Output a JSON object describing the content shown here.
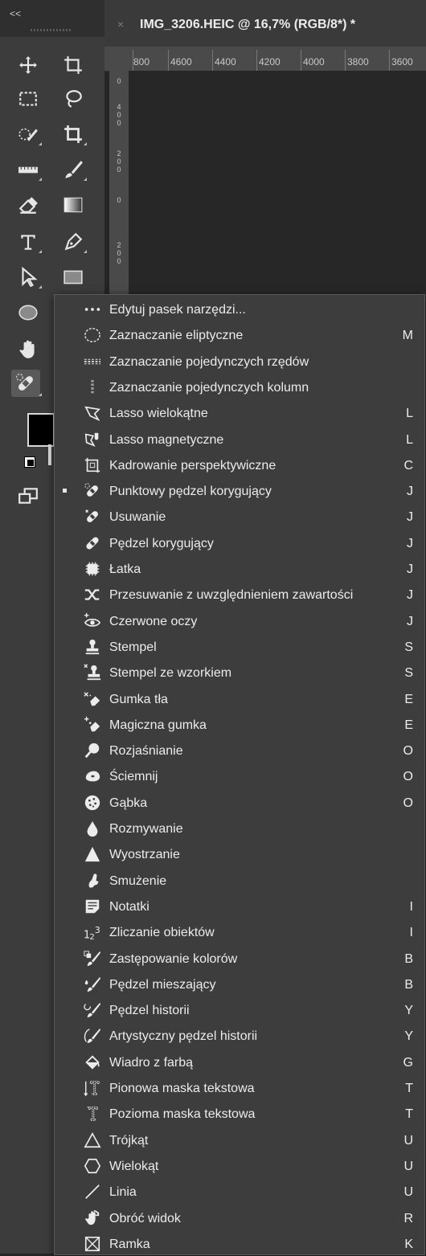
{
  "toolbar": {
    "collapse_label": "<<",
    "tools": [
      {
        "name": "move-tool",
        "icon": "move-icon"
      },
      {
        "name": "artboard-tool",
        "icon": "artboard-icon"
      },
      {
        "name": "rectangular-marquee-tool",
        "icon": "marquee-icon"
      },
      {
        "name": "lasso-tool",
        "icon": "lasso-icon"
      },
      {
        "name": "quick-selection-tool",
        "icon": "quick-selection-icon"
      },
      {
        "name": "crop-tool",
        "icon": "crop-icon"
      },
      {
        "name": "ruler-tool",
        "icon": "ruler-icon"
      },
      {
        "name": "brush-tool",
        "icon": "brush-icon"
      },
      {
        "name": "eraser-tool",
        "icon": "eraser-icon"
      },
      {
        "name": "gradient-tool",
        "icon": "gradient-icon"
      },
      {
        "name": "type-tool",
        "icon": "type-icon"
      },
      {
        "name": "pen-tool",
        "icon": "pen-icon"
      },
      {
        "name": "path-selection-tool",
        "icon": "arrow-icon"
      },
      {
        "name": "rectangle-tool",
        "icon": "rectangle-icon"
      },
      {
        "name": "ellipse-tool",
        "icon": "ellipse-icon"
      },
      {
        "name": "hand-tool",
        "icon": "hand-icon"
      },
      {
        "name": "spot-healing-brush-tool",
        "icon": "bandage-icon"
      },
      {
        "name": "change-screen-mode",
        "icon": "screen-mode-icon"
      }
    ],
    "foreground_color": "#000000"
  },
  "document": {
    "tab_close": "×",
    "tab_title": "IMG_3206.HEIC @ 16,7% (RGB/8*) *",
    "ruler_h": [
      "800",
      "4600",
      "4400",
      "4200",
      "4000",
      "3800",
      "3600"
    ],
    "ruler_v": [
      "0",
      "400",
      "200",
      "0",
      "200"
    ]
  },
  "menu": {
    "items": [
      {
        "icon": "ellipsis-icon",
        "label": "Edytuj pasek narzędzi...",
        "shortcut": ""
      },
      {
        "icon": "elliptical-marquee-icon",
        "label": "Zaznaczanie eliptyczne",
        "shortcut": "M"
      },
      {
        "icon": "single-row-marquee-icon",
        "label": "Zaznaczanie pojedynczych rzędów",
        "shortcut": ""
      },
      {
        "icon": "single-column-marquee-icon",
        "label": "Zaznaczanie pojedynczych kolumn",
        "shortcut": ""
      },
      {
        "icon": "polygonal-lasso-icon",
        "label": "Lasso wielokątne",
        "shortcut": "L"
      },
      {
        "icon": "magnetic-lasso-icon",
        "label": "Lasso magnetyczne",
        "shortcut": "L"
      },
      {
        "icon": "perspective-crop-icon",
        "label": "Kadrowanie perspektywiczne",
        "shortcut": "C"
      },
      {
        "icon": "spot-healing-brush-icon",
        "label": "Punktowy pędzel korygujący",
        "shortcut": "J",
        "selected": true
      },
      {
        "icon": "remove-tool-icon",
        "label": "Usuwanie",
        "shortcut": "J"
      },
      {
        "icon": "healing-brush-icon",
        "label": "Pędzel korygujący",
        "shortcut": "J"
      },
      {
        "icon": "patch-icon",
        "label": "Łatka",
        "shortcut": "J"
      },
      {
        "icon": "content-aware-move-icon",
        "label": "Przesuwanie z uwzględnieniem zawartości",
        "shortcut": "J"
      },
      {
        "icon": "red-eye-icon",
        "label": "Czerwone oczy",
        "shortcut": "J"
      },
      {
        "icon": "clone-stamp-icon",
        "label": "Stempel",
        "shortcut": "S"
      },
      {
        "icon": "pattern-stamp-icon",
        "label": "Stempel ze wzorkiem",
        "shortcut": "S"
      },
      {
        "icon": "background-eraser-icon",
        "label": "Gumka tła",
        "shortcut": "E"
      },
      {
        "icon": "magic-eraser-icon",
        "label": "Magiczna gumka",
        "shortcut": "E"
      },
      {
        "icon": "dodge-icon",
        "label": "Rozjaśnianie",
        "shortcut": "O"
      },
      {
        "icon": "burn-icon",
        "label": "Ściemnij",
        "shortcut": "O"
      },
      {
        "icon": "sponge-icon",
        "label": "Gąbka",
        "shortcut": "O"
      },
      {
        "icon": "blur-icon",
        "label": "Rozmywanie",
        "shortcut": ""
      },
      {
        "icon": "sharpen-icon",
        "label": "Wyostrzanie",
        "shortcut": ""
      },
      {
        "icon": "smudge-icon",
        "label": "Smużenie",
        "shortcut": ""
      },
      {
        "icon": "note-icon",
        "label": "Notatki",
        "shortcut": "I"
      },
      {
        "icon": "count-icon",
        "label": "Zliczanie obiektów",
        "shortcut": "I"
      },
      {
        "icon": "color-replacement-icon",
        "label": "Zastępowanie kolorów",
        "shortcut": "B"
      },
      {
        "icon": "mixer-brush-icon",
        "label": "Pędzel mieszający",
        "shortcut": "B"
      },
      {
        "icon": "history-brush-icon",
        "label": "Pędzel historii",
        "shortcut": "Y"
      },
      {
        "icon": "art-history-brush-icon",
        "label": "Artystyczny pędzel historii",
        "shortcut": "Y"
      },
      {
        "icon": "paint-bucket-icon",
        "label": "Wiadro z farbą",
        "shortcut": "G"
      },
      {
        "icon": "vertical-type-mask-icon",
        "label": "Pionowa maska tekstowa",
        "shortcut": "T"
      },
      {
        "icon": "horizontal-type-mask-icon",
        "label": "Pozioma maska tekstowa",
        "shortcut": "T"
      },
      {
        "icon": "triangle-icon",
        "label": "Trójkąt",
        "shortcut": "U"
      },
      {
        "icon": "polygon-icon",
        "label": "Wielokąt",
        "shortcut": "U"
      },
      {
        "icon": "line-icon",
        "label": "Linia",
        "shortcut": "U"
      },
      {
        "icon": "rotate-view-icon",
        "label": "Obróć widok",
        "shortcut": "R"
      },
      {
        "icon": "frame-icon",
        "label": "Ramka",
        "shortcut": "K"
      }
    ]
  }
}
